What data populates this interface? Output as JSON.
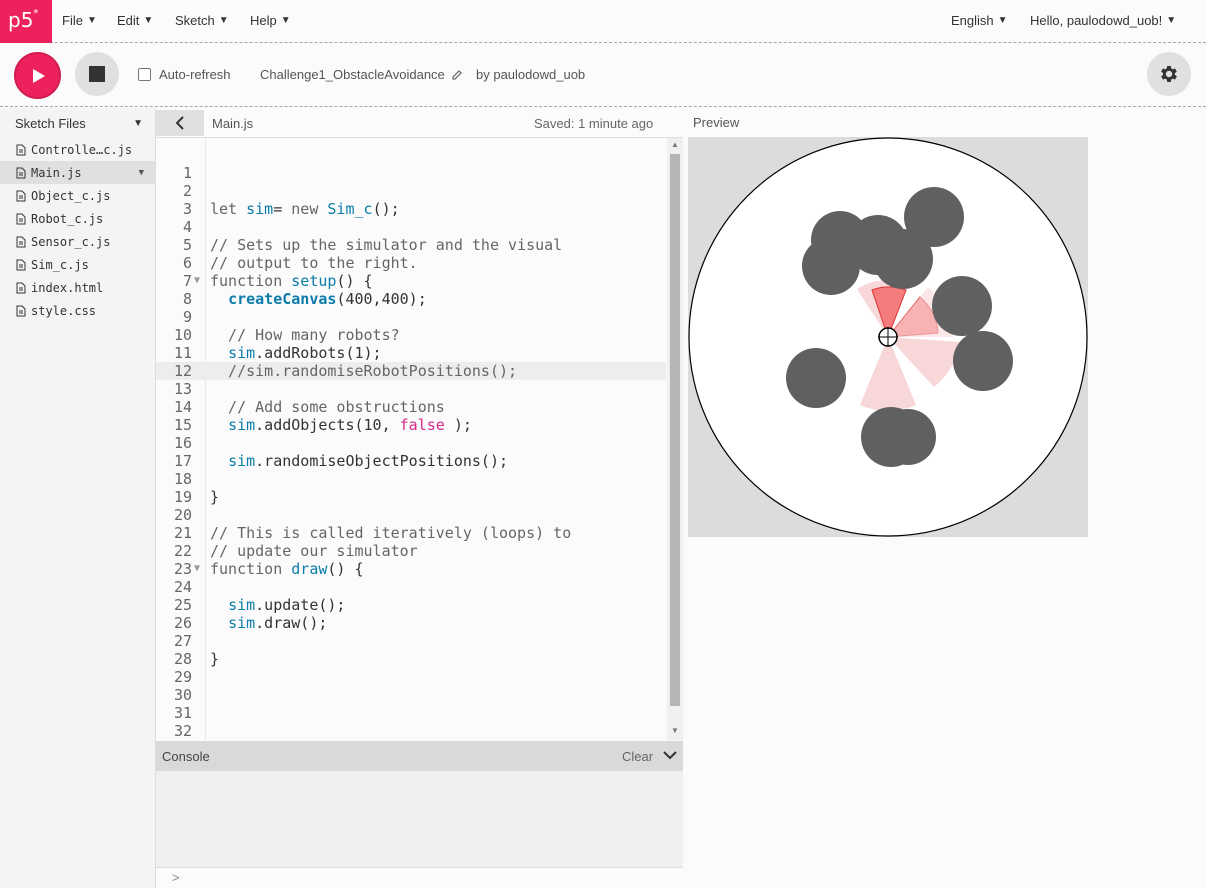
{
  "nav": {
    "logo": "p5",
    "logo_sup": "*",
    "menus": [
      "File",
      "Edit",
      "Sketch",
      "Help"
    ],
    "language": "English",
    "user_greeting": "Hello, paulodowd_uob!"
  },
  "toolbar": {
    "auto_refresh_label": "Auto-refresh",
    "project_name": "Challenge1_ObstacleAvoidance",
    "by_user": "by paulodowd_uob"
  },
  "sidebar": {
    "title": "Sketch Files",
    "files": [
      "Controlle…c.js",
      "Main.js",
      "Object_c.js",
      "Robot_c.js",
      "Sensor_c.js",
      "Sim_c.js",
      "index.html",
      "style.css"
    ],
    "active_file": "Main.js"
  },
  "editor": {
    "tab_name": "Main.js",
    "saved_status": "Saved: 1 minute ago",
    "active_line": 12,
    "line_numbers": [
      "1",
      "2",
      "3",
      "4",
      "5",
      "6",
      "7",
      "8",
      "9",
      "10",
      "11",
      "12",
      "13",
      "14",
      "15",
      "16",
      "17",
      "18",
      "19",
      "20",
      "21",
      "22",
      "23",
      "24",
      "25",
      "26",
      "27",
      "28",
      "29",
      "30",
      "31",
      "32"
    ],
    "lines": [
      [],
      [],
      [
        [
          "kw",
          "let "
        ],
        [
          "vr",
          "sim"
        ],
        [
          "",
          "= "
        ],
        [
          "kw",
          "new "
        ],
        [
          "vr",
          "Sim_c"
        ],
        [
          "",
          "();"
        ]
      ],
      [],
      [
        [
          "cm",
          "// Sets up the simulator and the visual"
        ]
      ],
      [
        [
          "cm",
          "// output to the right."
        ]
      ],
      [
        [
          "kw",
          "function "
        ],
        [
          "vr",
          "setup"
        ],
        [
          "",
          "() {"
        ]
      ],
      [
        [
          "",
          "  "
        ],
        [
          "fn",
          "createCanvas"
        ],
        [
          "",
          "(400,400);"
        ]
      ],
      [],
      [
        [
          "cm",
          "  // How many robots?"
        ]
      ],
      [
        [
          "",
          "  "
        ],
        [
          "vr",
          "sim"
        ],
        [
          "",
          ".addRobots(1);"
        ]
      ],
      [
        [
          "cm",
          "  //sim.randomiseRobotPositions();"
        ]
      ],
      [],
      [
        [
          "cm",
          "  // Add some obstructions"
        ]
      ],
      [
        [
          "",
          "  "
        ],
        [
          "vr",
          "sim"
        ],
        [
          "",
          ".addObjects(10, "
        ],
        [
          "bl",
          "false"
        ],
        [
          "",
          " );"
        ]
      ],
      [],
      [
        [
          "",
          "  "
        ],
        [
          "vr",
          "sim"
        ],
        [
          "",
          ".randomiseObjectPositions();"
        ]
      ],
      [],
      [
        [
          "",
          "}"
        ]
      ],
      [],
      [
        [
          "cm",
          "// This is called iteratively (loops) to"
        ]
      ],
      [
        [
          "cm",
          "// update our simulator"
        ]
      ],
      [
        [
          "kw",
          "function "
        ],
        [
          "vr",
          "draw"
        ],
        [
          "",
          "() {"
        ]
      ],
      [],
      [
        [
          "",
          "  "
        ],
        [
          "vr",
          "sim"
        ],
        [
          "",
          ".update();"
        ]
      ],
      [
        [
          "",
          "  "
        ],
        [
          "vr",
          "sim"
        ],
        [
          "",
          ".draw();"
        ]
      ],
      [],
      [
        [
          "",
          "}"
        ]
      ],
      [],
      [],
      [],
      []
    ],
    "fold_lines": [
      7,
      23
    ]
  },
  "console": {
    "label": "Console",
    "clear_label": "Clear",
    "prompt": ">"
  },
  "preview": {
    "label": "Preview",
    "canvas_bg": "#dcdcdc",
    "arena_fill": "#ffffff",
    "obstacle_color": "#606060",
    "sensor_color": "#f08080"
  },
  "colors": {
    "accent": "#ed225d",
    "keyword": "#666666",
    "variable": "#0b7ca9",
    "boolean": "#d52889"
  }
}
